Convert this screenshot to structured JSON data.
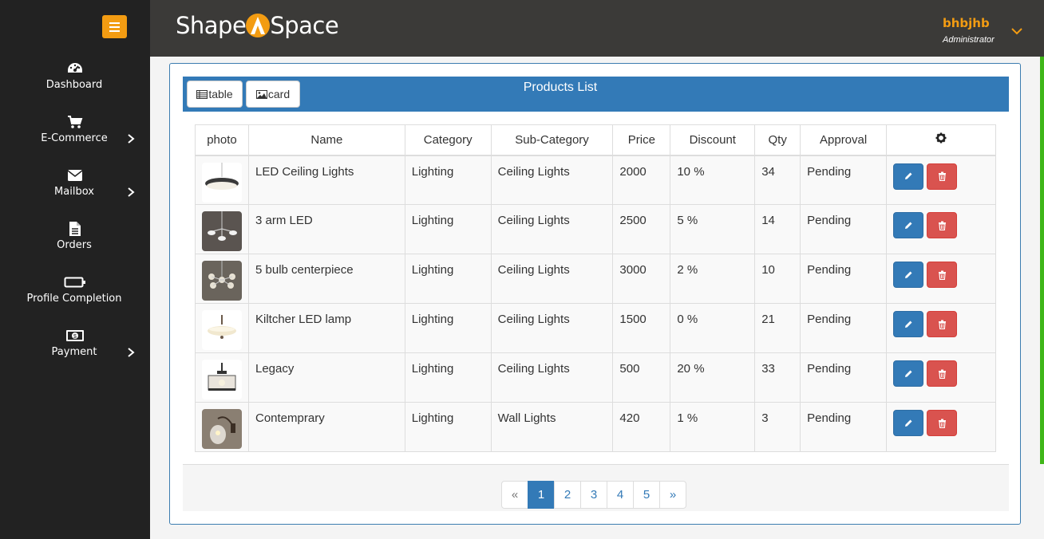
{
  "brand": {
    "logo_left": "Shape",
    "logo_right": "Space"
  },
  "user": {
    "name": "bhbjhb",
    "role": "Administrator"
  },
  "sidebar": {
    "items": [
      {
        "label": "Dashboard",
        "icon": "dashboard-icon",
        "has_submenu": false
      },
      {
        "label": "E-Commerce",
        "icon": "cart-icon",
        "has_submenu": true
      },
      {
        "label": "Mailbox",
        "icon": "envelope-icon",
        "has_submenu": true
      },
      {
        "label": "Orders",
        "icon": "file-icon",
        "has_submenu": false
      },
      {
        "label": "Profile Completion",
        "icon": "battery-icon",
        "has_submenu": false
      },
      {
        "label": "Payment",
        "icon": "money-icon",
        "has_submenu": true
      }
    ]
  },
  "panel": {
    "title": "Products List",
    "view_buttons": {
      "table": "table",
      "card": "card"
    }
  },
  "table": {
    "headers": [
      "photo",
      "Name",
      "Category",
      "Sub-Category",
      "Price",
      "Discount",
      "Qty",
      "Approval"
    ],
    "rows": [
      {
        "name": "LED Ceiling Lights",
        "category": "Lighting",
        "subcategory": "Ceiling Lights",
        "price": "2000",
        "discount": "10 %",
        "qty": "34",
        "approval": "Pending"
      },
      {
        "name": "3 arm LED",
        "category": "Lighting",
        "subcategory": "Ceiling Lights",
        "price": "2500",
        "discount": "5 %",
        "qty": "14",
        "approval": "Pending"
      },
      {
        "name": "5 bulb centerpiece",
        "category": "Lighting",
        "subcategory": "Ceiling Lights",
        "price": "3000",
        "discount": "2 %",
        "qty": "10",
        "approval": "Pending"
      },
      {
        "name": "Kiltcher LED lamp",
        "category": "Lighting",
        "subcategory": "Ceiling Lights",
        "price": "1500",
        "discount": "0 %",
        "qty": "21",
        "approval": "Pending"
      },
      {
        "name": "Legacy",
        "category": "Lighting",
        "subcategory": "Ceiling Lights",
        "price": "500",
        "discount": "20 %",
        "qty": "33",
        "approval": "Pending"
      },
      {
        "name": "Contemprary",
        "category": "Lighting",
        "subcategory": "Wall Lights",
        "price": "420",
        "discount": "1 %",
        "qty": "3",
        "approval": "Pending"
      }
    ]
  },
  "pagination": {
    "prev": "«",
    "pages": [
      "1",
      "2",
      "3",
      "4",
      "5"
    ],
    "next": "»",
    "active": "1"
  },
  "colors": {
    "accent": "#f39c12",
    "primary": "#337ab7",
    "danger": "#d9534f",
    "sidebar": "#222222",
    "header": "#3b3a38"
  }
}
